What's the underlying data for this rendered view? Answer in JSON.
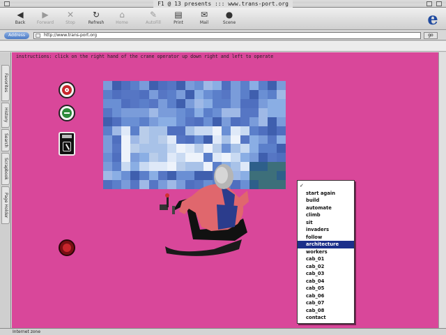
{
  "window": {
    "title": "F1 @ 13 presents ::: www.trans-port.org"
  },
  "toolbar": {
    "buttons": [
      {
        "label": "Back",
        "icon": "back-arrow-icon",
        "enabled": true
      },
      {
        "label": "Forward",
        "icon": "forward-arrow-icon",
        "enabled": false
      },
      {
        "label": "Stop",
        "icon": "stop-icon",
        "enabled": false
      },
      {
        "label": "Refresh",
        "icon": "refresh-icon",
        "enabled": true
      },
      {
        "label": "Home",
        "icon": "home-icon",
        "enabled": false
      },
      {
        "label": "AutoFill",
        "icon": "autofill-icon",
        "enabled": false
      },
      {
        "label": "Print",
        "icon": "print-icon",
        "enabled": true
      },
      {
        "label": "Mail",
        "icon": "mail-icon",
        "enabled": true
      },
      {
        "label": "Scene",
        "icon": "scene-icon",
        "enabled": true
      }
    ]
  },
  "address": {
    "label": "Address",
    "url": "http://www.trans-port.org",
    "go": "go"
  },
  "sidebar": {
    "tabs": [
      "Favorites",
      "History",
      "Search",
      "Scrapbook",
      "Page Holder"
    ]
  },
  "page": {
    "instructions": "instructions: click on the right hand of the crane operator up down right and left to operate",
    "menu": {
      "items": [
        "-",
        "start again",
        "build",
        "automate",
        "climb",
        "sit",
        "invaders",
        "follow",
        "architecture",
        "workers",
        "cab_01",
        "cab_02",
        "cab_03",
        "cab_04",
        "cab_05",
        "cab_06",
        "cab_07",
        "cab_08",
        "contact"
      ],
      "checked": "-",
      "selected": "architecture"
    }
  },
  "status": {
    "text": "Internet zone"
  },
  "colors": {
    "page_background": "#d9479a",
    "menu_selection": "#1b2f8a"
  }
}
